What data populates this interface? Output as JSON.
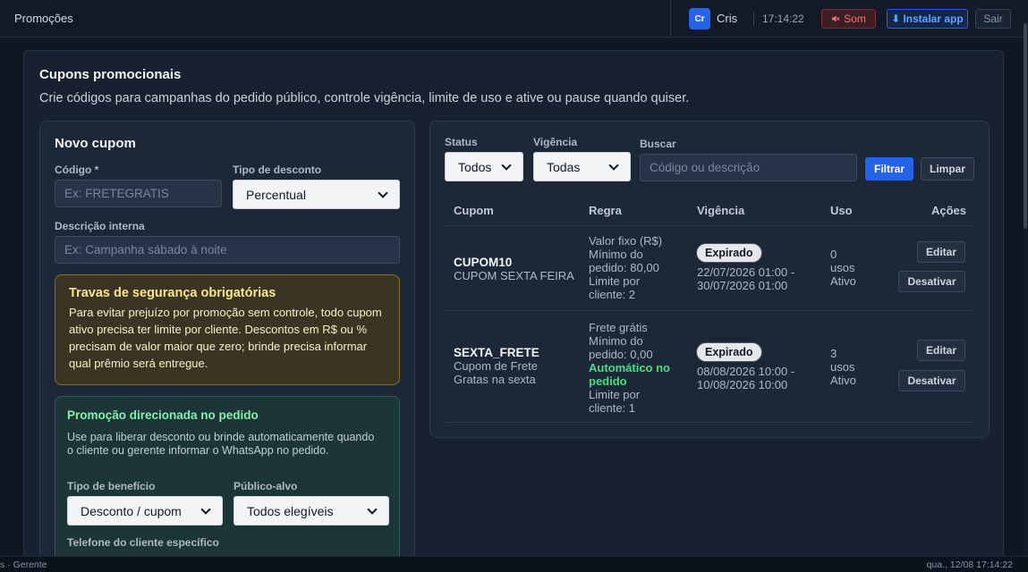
{
  "topbar": {
    "title": "Promoções",
    "user_initials": "Cr",
    "user_name": "Cris",
    "time": "17:14:22",
    "sound_label": "Som",
    "install_label": "Instalar app",
    "logout_label": "Sair"
  },
  "page": {
    "title": "Cupons promocionais",
    "subtitle": "Crie códigos para campanhas do pedido público, controle vigência, limite de uso e ative ou pause quando quiser."
  },
  "form": {
    "title": "Novo cupom",
    "code_label": "Código *",
    "code_placeholder": "Ex: FRETEGRATIS",
    "discount_type_label": "Tipo de desconto",
    "discount_type_value": "Percentual",
    "description_label": "Descrição interna",
    "description_placeholder": "Ex: Campanha sábado à noite",
    "warning_title": "Travas de segurança obrigatórias",
    "warning_text": "Para evitar prejuízo por promoção sem controle, todo cupom ativo precisa ter limite por cliente. Descontos em R$ ou % precisam de valor maior que zero; brinde precisa informar qual prêmio será entregue.",
    "targeted_title": "Promoção direcionada no pedido",
    "targeted_text": "Use para liberar desconto ou brinde automaticamente quando o cliente ou gerente informar o WhatsApp no pedido.",
    "benefit_type_label": "Tipo de benefício",
    "benefit_type_value": "Desconto / cupom",
    "audience_label": "Público-alvo",
    "audience_value": "Todos elegíveis",
    "phone_label": "Telefone do cliente específico"
  },
  "filters": {
    "status_label": "Status",
    "status_value": "Todos",
    "validity_label": "Vigência",
    "validity_value": "Todas",
    "search_label": "Buscar",
    "search_placeholder": "Código ou descrição",
    "filter_button": "Filtrar",
    "clear_button": "Limpar"
  },
  "table": {
    "headers": [
      "Cupom",
      "Regra",
      "Vigência",
      "Uso",
      "Ações"
    ],
    "rows": [
      {
        "code": "CUPOM10",
        "description": "CUPOM SEXTA FEIRA",
        "rule": [
          "Valor fixo (R$)",
          "Mínimo do",
          "pedido: 80,00",
          "Limite por",
          "cliente: 2"
        ],
        "badge": "Expirado",
        "validity": [
          "22/07/2026 01:00 -",
          "30/07/2026 01:00"
        ],
        "usage": [
          "0",
          "usos",
          "Ativo"
        ],
        "edit": "Editar",
        "toggle": "Desativar"
      },
      {
        "code": "SEXTA_FRETE",
        "description": [
          "Cupom de Frete",
          "Gratas na sexta"
        ],
        "rule": [
          "Frete grátis",
          "Mínimo do",
          "pedido: 0,00"
        ],
        "rule_auto": [
          "Automático no",
          "pedido"
        ],
        "rule_limit": [
          "Limite por",
          "cliente: 1"
        ],
        "badge": "Expirado",
        "validity": [
          "08/08/2026 10:00 -",
          "10/08/2026 10:00"
        ],
        "usage": [
          "3",
          "usos",
          "Ativo"
        ],
        "edit": "Editar",
        "toggle": "Desativar"
      }
    ]
  },
  "statusbar": {
    "left": "s · Gerente",
    "right": "qua., 12/08 17:14:22"
  },
  "colors": {
    "accent": "#2563eb",
    "warning": "#fde68a",
    "success": "#4ade80",
    "danger": "#f87171"
  }
}
